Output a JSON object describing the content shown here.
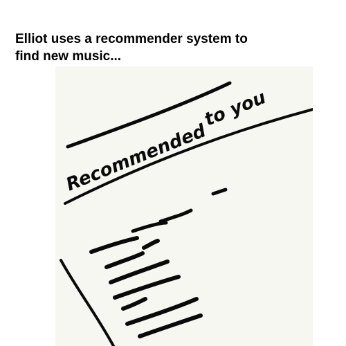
{
  "caption": {
    "line1": "Elliot uses a recommender system to",
    "line2": "find new music..."
  },
  "sketch": {
    "heading_line1": "Recommended to you",
    "heading_fragment_a": "Recommended",
    "heading_fragment_b": "to you"
  },
  "colors": {
    "ink": "#0a0a0a",
    "paper": "#f7f7f2",
    "background": "#ffffff",
    "caption_text": "#000000"
  }
}
